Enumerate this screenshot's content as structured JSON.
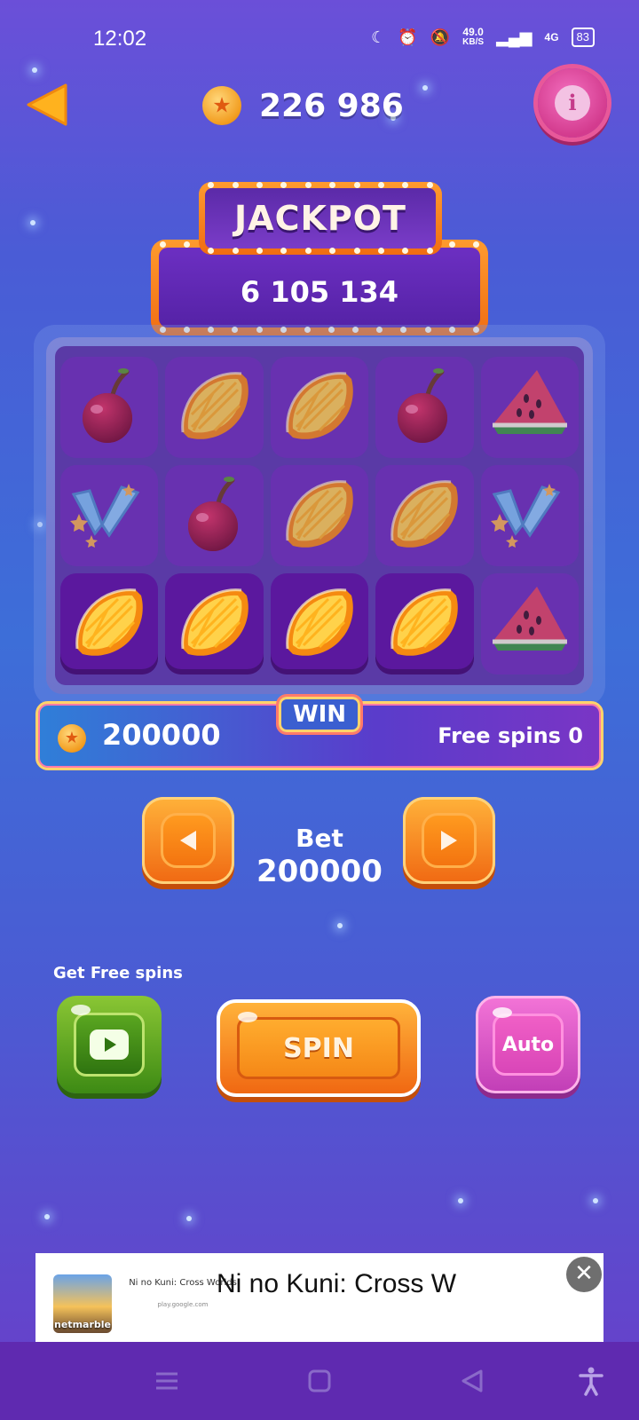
{
  "status_bar": {
    "time": "12:02",
    "net_speed_value": "49.0",
    "net_speed_unit": "KB/S",
    "network_type": "4G",
    "battery": "83"
  },
  "header": {
    "balance": "226 986",
    "icons": [
      "back-arrow-icon",
      "coin-icon",
      "info-icon"
    ]
  },
  "jackpot": {
    "title": "JACKPOT",
    "value": "6 105 134"
  },
  "reels": [
    [
      "cherry",
      "orange",
      "orange",
      "cherry",
      "watermelon"
    ],
    [
      "bonus-v",
      "cherry",
      "orange",
      "orange",
      "bonus-v"
    ],
    [
      "orange",
      "orange",
      "orange",
      "orange",
      "watermelon"
    ]
  ],
  "win_row_index": 2,
  "win_bar": {
    "label": "WIN",
    "amount": "200000",
    "free_spins": "Free spins 0"
  },
  "bet": {
    "label": "Bet",
    "value": "200000"
  },
  "controls": {
    "free_spins_title": "Get Free spins",
    "spin_label": "SPIN",
    "auto_label": "Auto"
  },
  "ad": {
    "title": "Ni no Kuni: Cross W",
    "small_title": "Ni no Kuni: Cross Worlds",
    "small_url": "play.google.com",
    "brand": "netmarble",
    "close": "✕"
  },
  "colors": {
    "accent_orange": "#f06812",
    "jackpot_purple": "#5b2aa8",
    "auto_pink": "#d946b8",
    "video_green": "#3d8a14"
  }
}
